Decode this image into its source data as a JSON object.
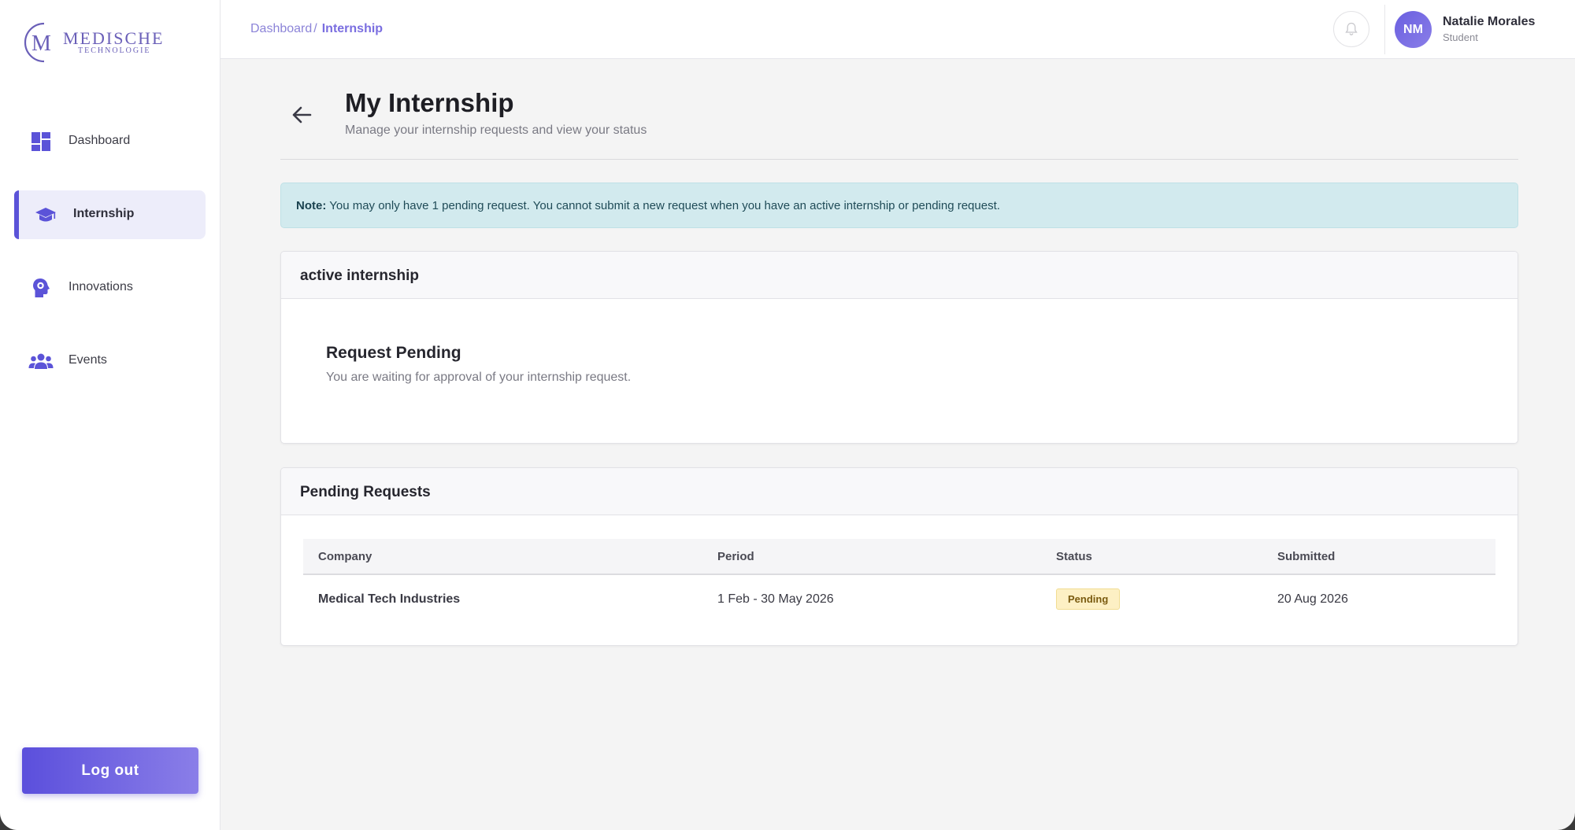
{
  "brand": {
    "word": "MEDISCHE",
    "sub": "TECHNOLOGIE",
    "mark": "M"
  },
  "sidebar": {
    "items": [
      {
        "label": "Dashboard",
        "icon": "dashboard-icon"
      },
      {
        "label": "Internship",
        "icon": "graduation-cap-icon",
        "active": true
      },
      {
        "label": "Innovations",
        "icon": "head-gear-icon"
      },
      {
        "label": "Events",
        "icon": "people-icon"
      }
    ],
    "logout_label": "Log out"
  },
  "topbar": {
    "breadcrumb": {
      "parent": "Dashboard",
      "separator": "/",
      "current": "Internship"
    },
    "user": {
      "initials": "NM",
      "name": "Natalie Morales",
      "role": "Student"
    }
  },
  "page": {
    "title": "My Internship",
    "subtitle": "Manage your internship requests and view your status"
  },
  "note": {
    "label": "Note:",
    "text": " You may only have 1 pending request. You cannot submit a new request when you have an active internship or pending request."
  },
  "active_card": {
    "header": "active internship",
    "status_title": "Request Pending",
    "status_desc": "You are waiting for approval of your internship request."
  },
  "requests_card": {
    "header": "Pending Requests",
    "columns": [
      "Company",
      "Period",
      "Status",
      "Submitted"
    ],
    "rows": [
      {
        "company": "Medical Tech Industries",
        "period": "1 Feb - 30 May 2026",
        "status": "Pending",
        "submitted": "20 Aug 2026"
      }
    ]
  },
  "colors": {
    "accent": "#5b53d8",
    "note_bg": "#d2eaee",
    "badge_bg": "#fdf0c4"
  }
}
